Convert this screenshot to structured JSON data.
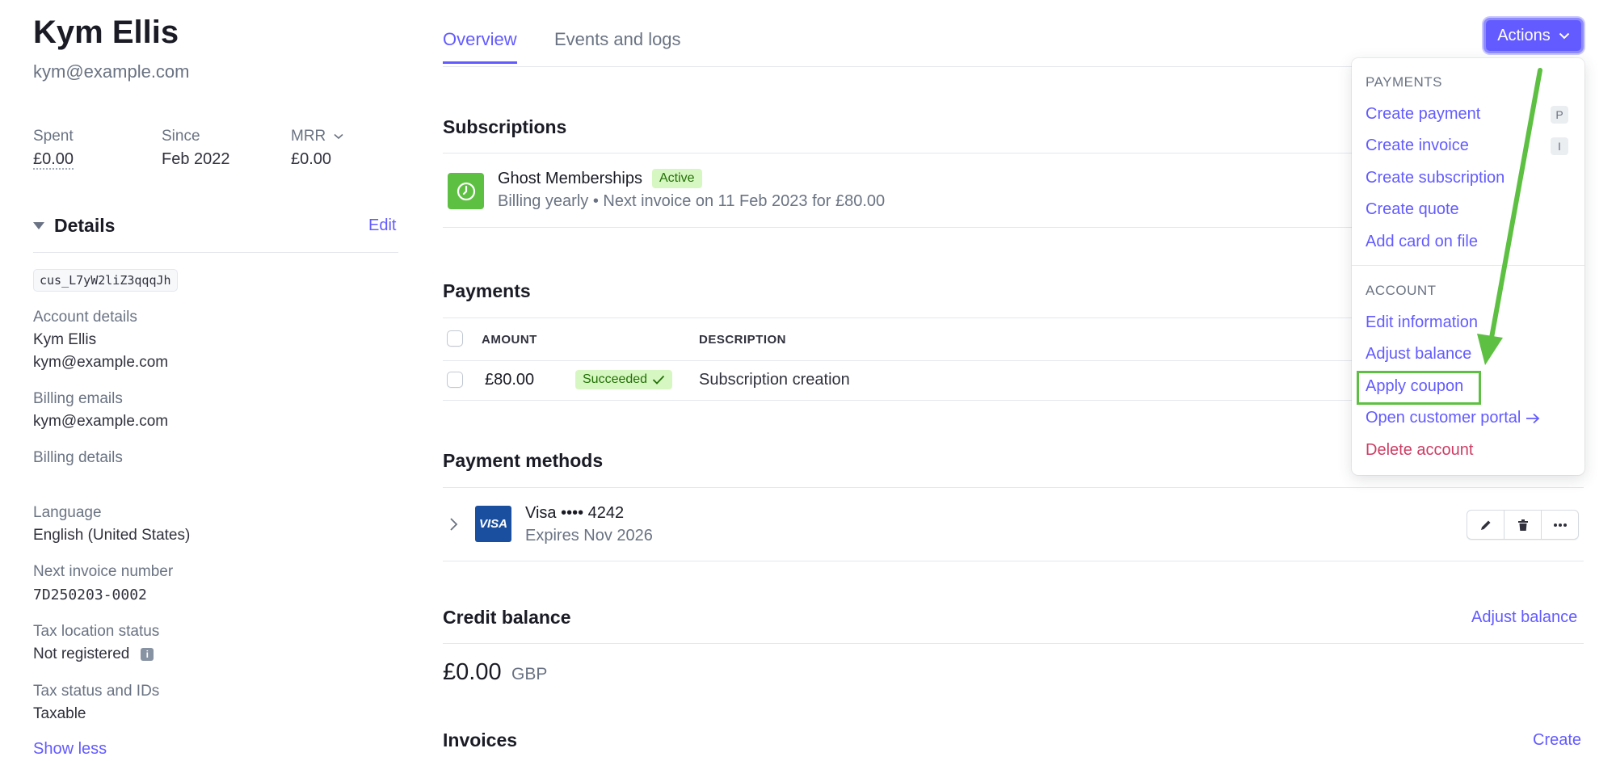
{
  "customer": {
    "name": "Kym Ellis",
    "email": "kym@example.com"
  },
  "stats": [
    {
      "label": "Spent",
      "value": "£0.00"
    },
    {
      "label": "Since",
      "value": "Feb 2022"
    },
    {
      "label": "MRR",
      "value": "£0.00"
    }
  ],
  "details": {
    "title": "Details",
    "edit_label": "Edit",
    "customer_id": "cus_L7yW2liZ3qqqJh",
    "account_details_label": "Account details",
    "account_name": "Kym Ellis",
    "account_email": "kym@example.com",
    "billing_emails_label": "Billing emails",
    "billing_email": "kym@example.com",
    "billing_details_label": "Billing details",
    "language_label": "Language",
    "language_value": "English (United States)",
    "next_invoice_label": "Next invoice number",
    "next_invoice_value": "7D250203-0002",
    "tax_location_label": "Tax location status",
    "tax_location_value": "Not registered",
    "tax_status_label": "Tax status and IDs",
    "tax_status_value": "Taxable",
    "show_less_label": "Show less"
  },
  "tabs": [
    {
      "label": "Overview",
      "active": true
    },
    {
      "label": "Events and logs",
      "active": false
    }
  ],
  "subscriptions": {
    "title": "Subscriptions",
    "name": "Ghost Memberships",
    "status": "Active",
    "billing": "Billing yearly",
    "next_invoice": "Next invoice on 11 Feb 2023 for £80.00"
  },
  "payments": {
    "title": "Payments",
    "columns": [
      "AMOUNT",
      "DESCRIPTION"
    ],
    "rows": [
      {
        "amount": "£80.00",
        "status": "Succeeded",
        "description": "Subscription creation"
      }
    ]
  },
  "payment_methods": {
    "title": "Payment methods",
    "brand_logo": "VISA",
    "name": "Visa •••• 4242",
    "expiry": "Expires Nov 2026"
  },
  "credit_balance": {
    "title": "Credit balance",
    "adjust_label": "Adjust balance",
    "amount": "£0.00",
    "currency": "GBP"
  },
  "invoices": {
    "title": "Invoices",
    "create_label": "Create"
  },
  "actions": {
    "button_label": "Actions",
    "payments_section": "PAYMENTS",
    "account_section": "ACCOUNT",
    "payment_items": [
      {
        "label": "Create payment",
        "shortcut": "P"
      },
      {
        "label": "Create invoice",
        "shortcut": "I"
      },
      {
        "label": "Create subscription"
      },
      {
        "label": "Create quote"
      },
      {
        "label": "Add card on file"
      }
    ],
    "account_items": [
      {
        "label": "Edit information"
      },
      {
        "label": "Adjust balance"
      },
      {
        "label": "Apply coupon"
      },
      {
        "label": "Open customer portal"
      },
      {
        "label": "Delete account"
      }
    ]
  },
  "colors": {
    "accent": "#635bff",
    "success": "#5ec042",
    "danger": "#cd3d64",
    "annotation": "#5ec042"
  }
}
